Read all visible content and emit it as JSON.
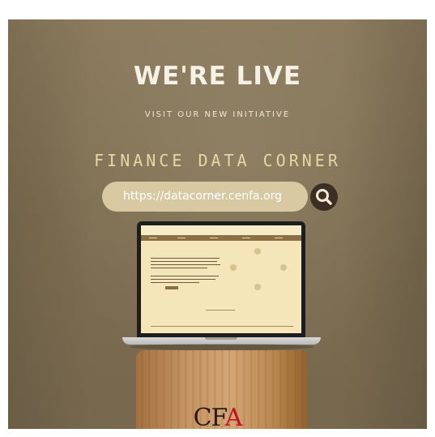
{
  "headline": "WE'RE LIVE",
  "subheadline": "VISIT OUR NEW INITIATIVE",
  "program_title": "FINANCE DATA CORNER",
  "url": "https://datacorner.cenfa.org",
  "icons": {
    "search": "search-icon",
    "logo": "cfa-logo"
  },
  "logo": {
    "text_main": "CF",
    "text_accent": "A"
  },
  "colors": {
    "background": "#7f6f53",
    "headline": "#f6f1e6",
    "title": "#e8d6a6",
    "url_pill": "#d9c9a2",
    "search_button": "#3a2f22",
    "logo_accent": "#c1121f"
  }
}
